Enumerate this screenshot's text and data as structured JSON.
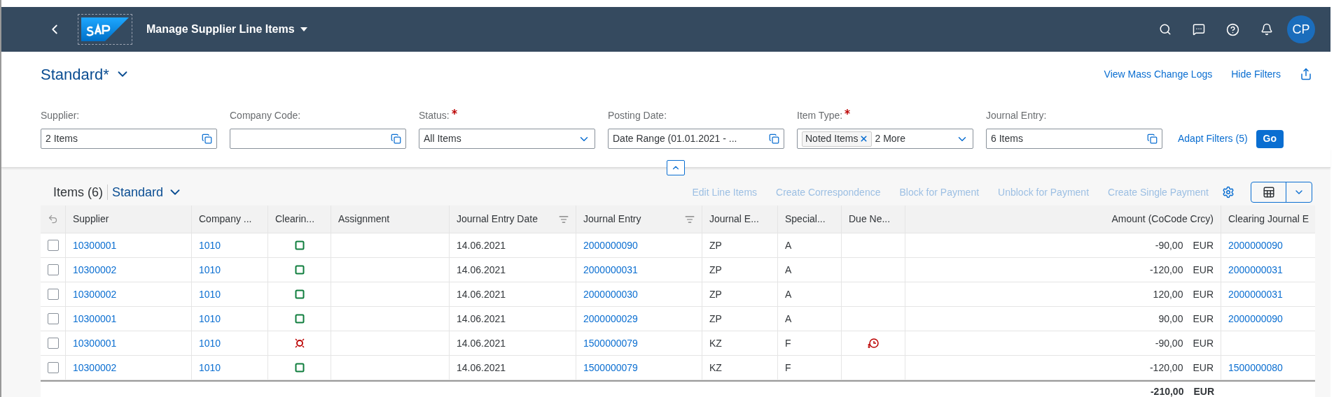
{
  "shell": {
    "title": "Manage Supplier Line Items",
    "avatar": "CP"
  },
  "variant": {
    "name": "Standard*"
  },
  "header_links": [
    "View Mass Change Logs",
    "Hide Filters"
  ],
  "filters": [
    {
      "label": "Supplier:",
      "required": false,
      "kind": "valuehelp",
      "value": "2 Items"
    },
    {
      "label": "Company Code:",
      "required": false,
      "kind": "valuehelp"
    },
    {
      "label": "Status:",
      "required": true,
      "kind": "dropdown",
      "value": "All Items"
    },
    {
      "label": "Posting Date:",
      "required": false,
      "kind": "valuehelp",
      "value": "Date Range (01.01.2021 - ..."
    },
    {
      "label": "Item Type:",
      "required": true,
      "kind": "tokens",
      "token": "Noted Items",
      "more": "2 More"
    },
    {
      "label": "Journal Entry:",
      "required": false,
      "kind": "valuehelp",
      "value": "6 Items"
    }
  ],
  "adapt_filters": "Adapt Filters (5)",
  "go": "Go",
  "table": {
    "title": "Items (6)",
    "variant": "Standard",
    "actions": [
      {
        "label": "Edit Line Items",
        "disabled": true
      },
      {
        "label": "Create Correspondence",
        "disabled": true
      },
      {
        "label": "Block for Payment",
        "disabled": true
      },
      {
        "label": "Unblock for Payment",
        "disabled": true
      },
      {
        "label": "Create Single Payment",
        "disabled": true
      }
    ],
    "columns": [
      {
        "label": "Supplier",
        "sorted": false
      },
      {
        "label": "Company ...",
        "sorted": false
      },
      {
        "label": "Clearin...",
        "sorted": false
      },
      {
        "label": "Assignment",
        "sorted": false
      },
      {
        "label": "Journal Entry Date",
        "sorted": true
      },
      {
        "label": "Journal Entry",
        "sorted": true
      },
      {
        "label": "Journal E...",
        "sorted": false
      },
      {
        "label": "Special...",
        "sorted": false
      },
      {
        "label": "Due Ne...",
        "sorted": false
      },
      {
        "label": "Amount (CoCode Crcy)",
        "sorted": false
      },
      {
        "label": "Clearing Journal E",
        "sorted": false
      }
    ],
    "rows": [
      {
        "selected": false,
        "supplier": "10300001",
        "company_code": "1010",
        "clearing": {
          "kind": "cleared"
        },
        "date": "14.06.2021",
        "journal_entry": "2000000090",
        "je_type": "ZP",
        "special": "A",
        "overdue": false,
        "amount": "-90,00",
        "currency": "EUR",
        "clearing_entry": "2000000090"
      },
      {
        "selected": false,
        "supplier": "10300002",
        "company_code": "1010",
        "clearing": {
          "kind": "cleared"
        },
        "date": "14.06.2021",
        "journal_entry": "2000000031",
        "je_type": "ZP",
        "special": "A",
        "overdue": false,
        "amount": "-120,00",
        "currency": "EUR",
        "clearing_entry": "2000000031"
      },
      {
        "selected": false,
        "supplier": "10300002",
        "company_code": "1010",
        "clearing": {
          "kind": "cleared"
        },
        "date": "14.06.2021",
        "journal_entry": "2000000030",
        "je_type": "ZP",
        "special": "A",
        "overdue": false,
        "amount": "120,00",
        "currency": "EUR",
        "clearing_entry": "2000000031"
      },
      {
        "selected": false,
        "supplier": "10300001",
        "company_code": "1010",
        "clearing": {
          "kind": "cleared"
        },
        "date": "14.06.2021",
        "journal_entry": "2000000029",
        "je_type": "ZP",
        "special": "A",
        "overdue": false,
        "amount": "90,00",
        "currency": "EUR",
        "clearing_entry": "2000000090"
      },
      {
        "selected": false,
        "supplier": "10300001",
        "company_code": "1010",
        "clearing": {
          "kind": "open"
        },
        "date": "14.06.2021",
        "journal_entry": "1500000079",
        "je_type": "KZ",
        "special": "F",
        "overdue": true,
        "amount": "-90,00",
        "currency": "EUR"
      },
      {
        "selected": false,
        "supplier": "10300002",
        "company_code": "1010",
        "clearing": {
          "kind": "cleared"
        },
        "date": "14.06.2021",
        "journal_entry": "1500000079",
        "je_type": "KZ",
        "special": "F",
        "overdue": false,
        "amount": "-120,00",
        "currency": "EUR",
        "clearing_entry": "1500000080"
      }
    ],
    "total": {
      "amount": "-210,00",
      "currency": "EUR"
    }
  }
}
